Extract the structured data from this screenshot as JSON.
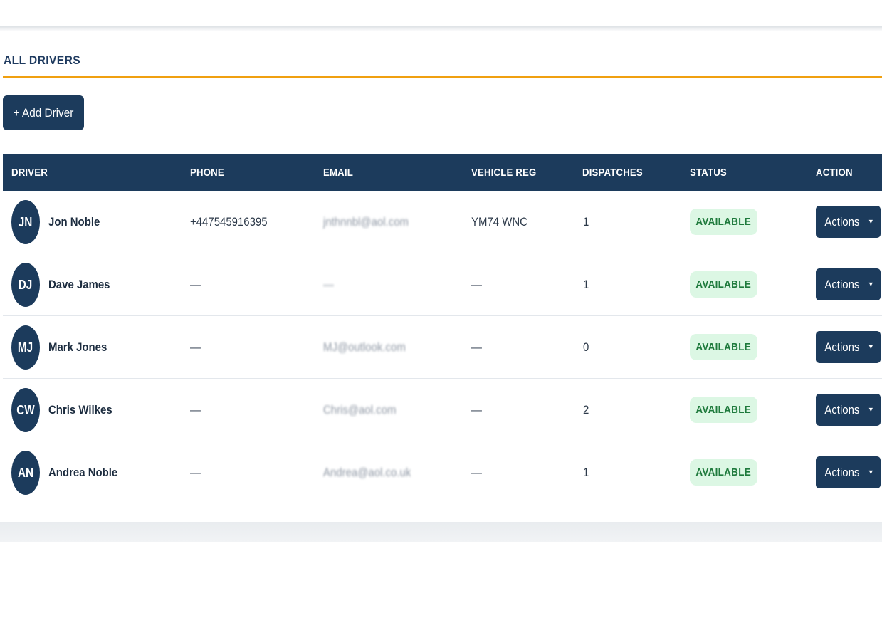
{
  "page": {
    "section_title": "ALL DRIVERS",
    "add_button_label": "+ Add Driver"
  },
  "table": {
    "headers": {
      "driver": "DRIVER",
      "phone": "PHONE",
      "email": "EMAIL",
      "vehicle_reg": "VEHICLE REG",
      "dispatches": "DISPATCHES",
      "status": "STATUS",
      "action": "ACTION"
    },
    "rows": [
      {
        "initials": "JN",
        "name": "Jon Noble",
        "phone": "+447545916395",
        "email": "jnthnnbl@aol.com",
        "vehicle_reg": "YM74 WNC",
        "dispatches": "1",
        "status": "AVAILABLE",
        "action_label": "Actions"
      },
      {
        "initials": "DJ",
        "name": "Dave James",
        "phone": "—",
        "email": "—",
        "vehicle_reg": "—",
        "dispatches": "1",
        "status": "AVAILABLE",
        "action_label": "Actions"
      },
      {
        "initials": "MJ",
        "name": "Mark Jones",
        "phone": "—",
        "email": "MJ@outlook.com",
        "vehicle_reg": "—",
        "dispatches": "0",
        "status": "AVAILABLE",
        "action_label": "Actions"
      },
      {
        "initials": "CW",
        "name": "Chris Wilkes",
        "phone": "—",
        "email": "Chris@aol.com",
        "vehicle_reg": "—",
        "dispatches": "2",
        "status": "AVAILABLE",
        "action_label": "Actions"
      },
      {
        "initials": "AN",
        "name": "Andrea Noble",
        "phone": "—",
        "email": "Andrea@aol.co.uk",
        "vehicle_reg": "—",
        "dispatches": "1",
        "status": "AVAILABLE",
        "action_label": "Actions"
      }
    ]
  },
  "icons": {
    "action_caret": "caret-down-icon"
  },
  "colors": {
    "primary": "#1c3b5c",
    "accent_underline": "#f0a010",
    "status_bg": "#dcf7e4",
    "status_text": "#1e7a3c"
  }
}
